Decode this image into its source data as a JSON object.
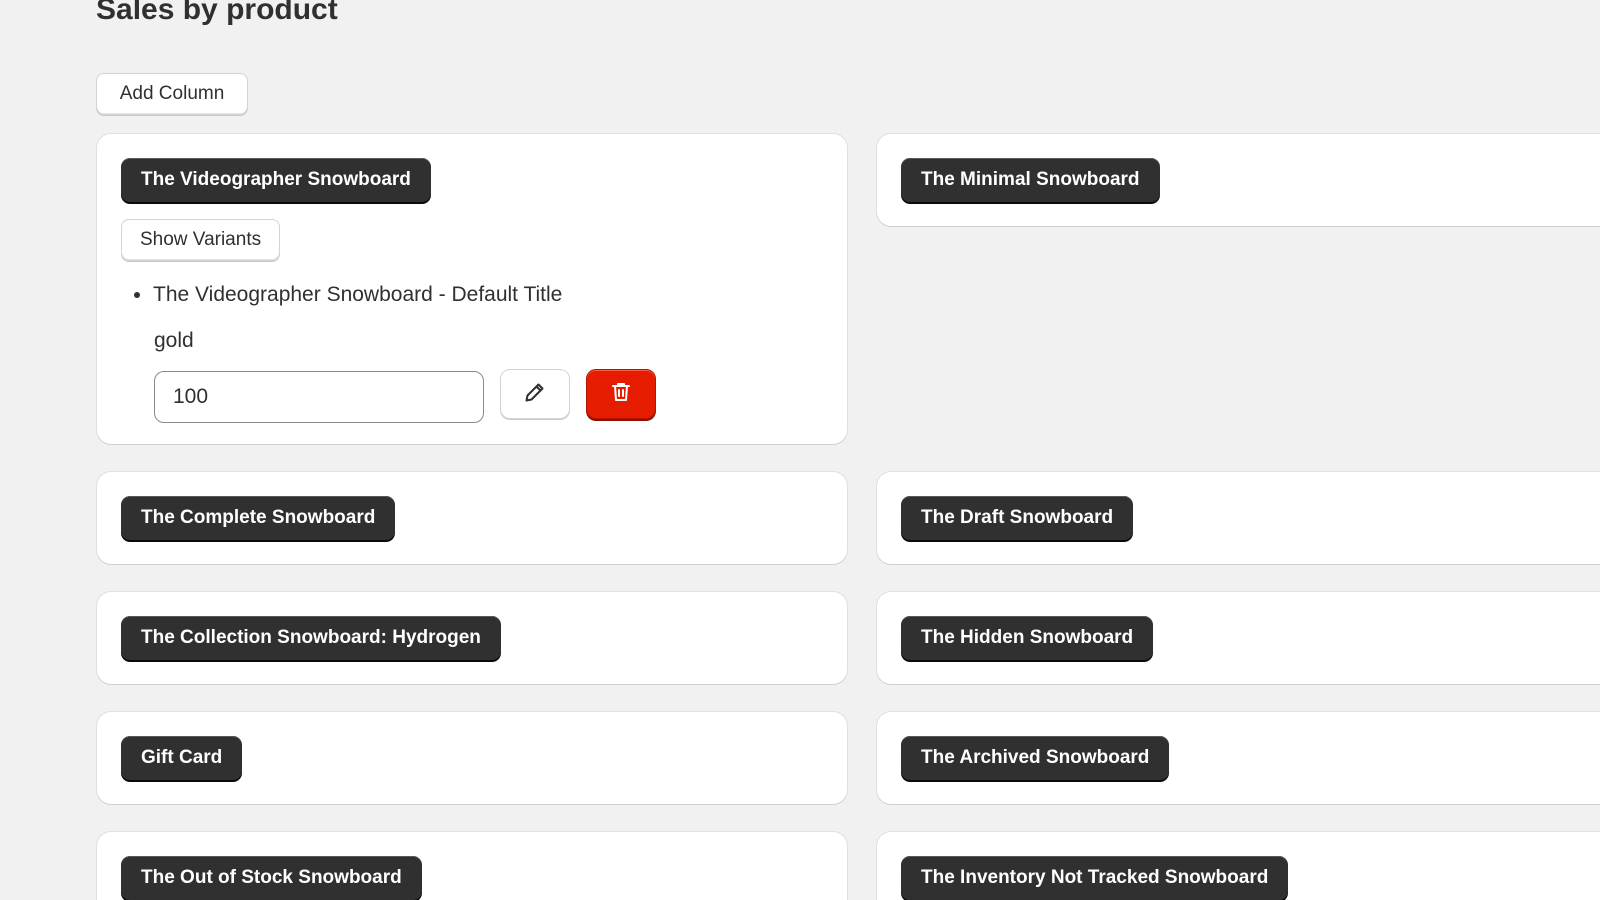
{
  "page": {
    "title": "Sales by product",
    "add_column_label": "Add Column"
  },
  "products_left": [
    {
      "name": "The Videographer Snowboard",
      "expanded": true,
      "show_variants_label": "Show Variants",
      "variants": [
        {
          "title": "The Videographer Snowboard - Default Title",
          "tag": "gold",
          "value": "100"
        }
      ]
    },
    {
      "name": "The Complete Snowboard"
    },
    {
      "name": "The Collection Snowboard: Hydrogen"
    },
    {
      "name": "Gift Card"
    },
    {
      "name": "The Out of Stock Snowboard"
    }
  ],
  "products_right": [
    {
      "name": "The Minimal Snowboard"
    },
    {
      "name": "The Draft Snowboard"
    },
    {
      "name": "The Hidden Snowboard"
    },
    {
      "name": "The Archived Snowboard"
    },
    {
      "name": "The Inventory Not Tracked Snowboard"
    }
  ],
  "icons": {
    "edit": "pencil-icon",
    "delete": "trash-icon"
  },
  "colors": {
    "background": "#f1f1f1",
    "card": "#ffffff",
    "pill": "#303030",
    "danger": "#e51c00"
  }
}
